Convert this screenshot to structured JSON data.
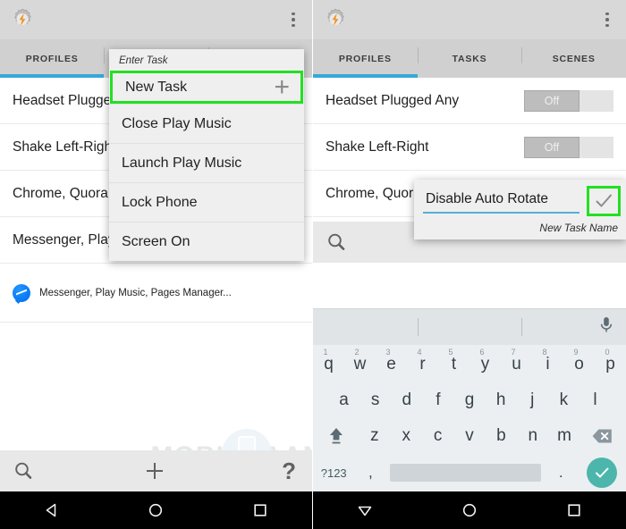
{
  "app": {
    "name": "Tasker",
    "icon": "tasker-gear-bolt-icon",
    "overflow_label": "More options"
  },
  "tabs": [
    {
      "label": "PROFILES",
      "active": true
    },
    {
      "label": "TASKS",
      "active": false
    },
    {
      "label": "SCENES",
      "active": false
    }
  ],
  "left_panel": {
    "profiles": [
      {
        "title": "Headset Plugged",
        "type": "text"
      },
      {
        "title": "Shake Left-Right",
        "type": "text"
      },
      {
        "title": "Chrome, Quora, ",
        "type": "text"
      },
      {
        "title": "Messenger, Play",
        "type": "text"
      }
    ],
    "messenger_row": {
      "icon": "messenger-icon",
      "title": "Messenger, Play Music, Pages Manager..."
    },
    "dialog": {
      "title": "Enter Task",
      "items": [
        {
          "label": "New Task",
          "trailing_icon": "plus-icon",
          "highlighted": true
        },
        {
          "label": "Close Play Music",
          "highlighted": false
        },
        {
          "label": "Launch Play Music",
          "highlighted": false
        },
        {
          "label": "Lock Phone",
          "highlighted": false
        },
        {
          "label": "Screen On",
          "highlighted": false
        }
      ]
    },
    "bottom_toolbar": [
      {
        "icon": "search-icon",
        "name": "search-button"
      },
      {
        "icon": "plus-icon",
        "name": "add-button"
      },
      {
        "icon": "question-mark-icon",
        "label": "?",
        "name": "help-button"
      }
    ]
  },
  "right_panel": {
    "profiles": [
      {
        "title": "Headset Plugged Any",
        "toggle": "Off"
      },
      {
        "title": "Shake Left-Right",
        "toggle": "Off"
      },
      {
        "title": "Chrome, Quora",
        "toggle": ""
      }
    ],
    "dialog": {
      "input_value": "Disable Auto Rotate",
      "input_placeholder": "New Task Name",
      "caption": "New Task Name",
      "confirm_icon": "check-icon"
    },
    "search_icon": "search-icon",
    "keyboard": {
      "mic_icon": "microphone-icon",
      "row1": [
        {
          "key": "q",
          "alt": "1"
        },
        {
          "key": "w",
          "alt": "2"
        },
        {
          "key": "e",
          "alt": "3"
        },
        {
          "key": "r",
          "alt": "4"
        },
        {
          "key": "t",
          "alt": "5"
        },
        {
          "key": "y",
          "alt": "6"
        },
        {
          "key": "u",
          "alt": "7"
        },
        {
          "key": "i",
          "alt": "8"
        },
        {
          "key": "o",
          "alt": "9"
        },
        {
          "key": "p",
          "alt": "0"
        }
      ],
      "row2": [
        "a",
        "s",
        "d",
        "f",
        "g",
        "h",
        "j",
        "k",
        "l"
      ],
      "row3": [
        "z",
        "x",
        "c",
        "v",
        "b",
        "n",
        "m"
      ],
      "shift_icon": "shift-icon",
      "backspace_icon": "backspace-icon",
      "symbols_key": "?123",
      "comma_key": ",",
      "period_key": ".",
      "enter_icon": "check-icon"
    }
  },
  "navbar": [
    {
      "icon": "back-triangle-icon",
      "name": "nav-back"
    },
    {
      "icon": "home-circle-icon",
      "name": "nav-home"
    },
    {
      "icon": "recents-square-icon",
      "name": "nav-recents"
    }
  ],
  "watermark": {
    "text": "MOBIGYAAN"
  },
  "colors": {
    "accent_blue": "#36a8d8",
    "highlight_green": "#22e022",
    "appbar_gray": "#d8d8d8",
    "tabbar_gray": "#d0d0d0",
    "enter_teal": "#4db6ac",
    "keyboard_bg": "#eceff1"
  }
}
